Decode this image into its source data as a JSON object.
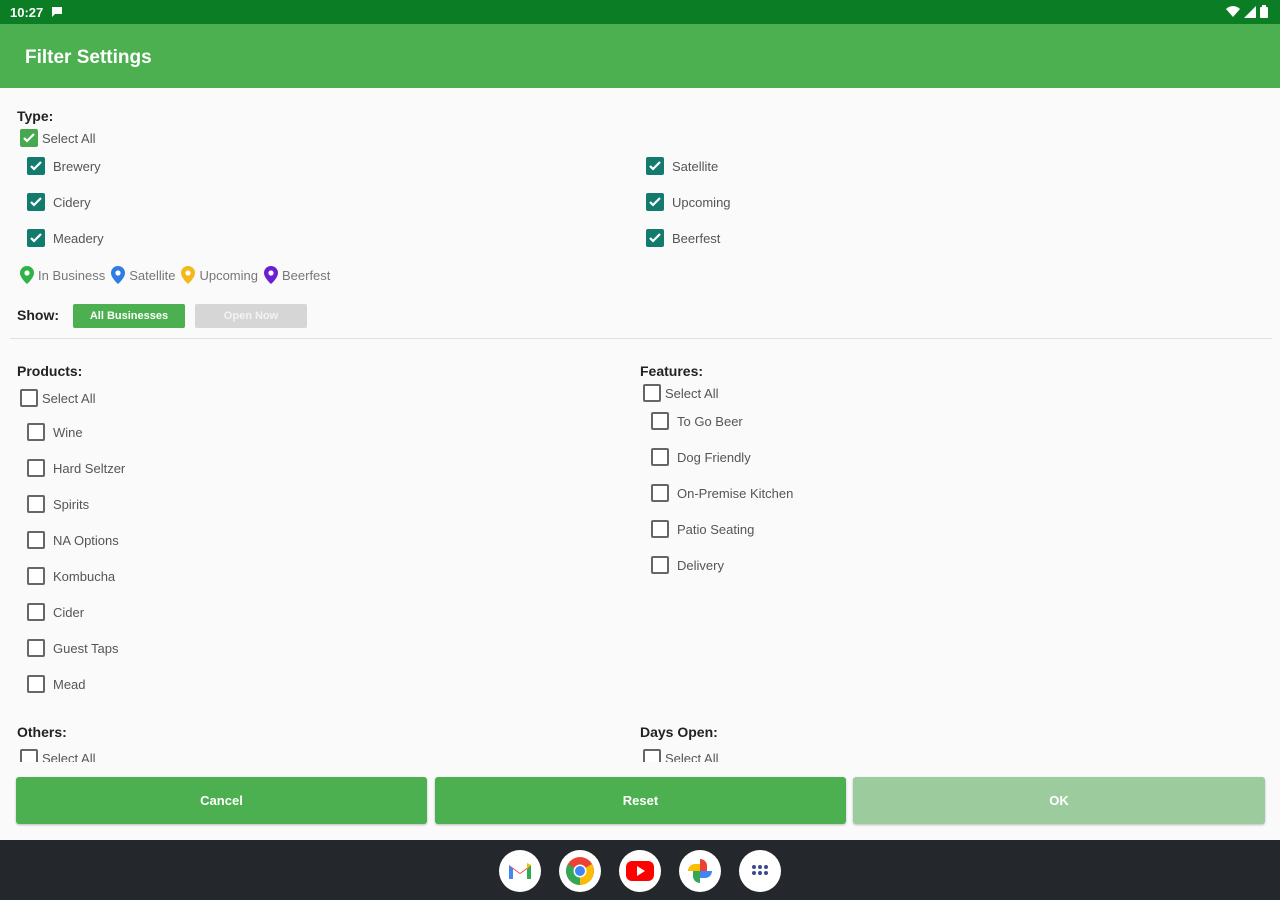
{
  "status_bar": {
    "time": "10:27"
  },
  "app_bar": {
    "title": "Filter Settings"
  },
  "type_section": {
    "label": "Type:",
    "select_all": {
      "label": "Select All",
      "checked": true
    },
    "items_left": [
      {
        "label": "Brewery",
        "checked": true
      },
      {
        "label": "Cidery",
        "checked": true
      },
      {
        "label": "Meadery",
        "checked": true
      }
    ],
    "items_right": [
      {
        "label": "Satellite",
        "checked": true
      },
      {
        "label": "Upcoming",
        "checked": true
      },
      {
        "label": "Beerfest",
        "checked": true
      }
    ]
  },
  "legend": [
    {
      "label": "In Business",
      "color": "#2fb344"
    },
    {
      "label": "Satellite",
      "color": "#2f7de1"
    },
    {
      "label": "Upcoming",
      "color": "#f1b91c"
    },
    {
      "label": "Beerfest",
      "color": "#6a1fd0"
    }
  ],
  "show": {
    "label": "Show:",
    "options": [
      {
        "label": "All Businesses",
        "active": true
      },
      {
        "label": "Open Now",
        "active": false
      }
    ]
  },
  "products": {
    "label": "Products:",
    "select_all": {
      "label": "Select All",
      "checked": false
    },
    "items": [
      {
        "label": "Wine",
        "checked": false
      },
      {
        "label": "Hard Seltzer",
        "checked": false
      },
      {
        "label": "Spirits",
        "checked": false
      },
      {
        "label": "NA Options",
        "checked": false
      },
      {
        "label": "Kombucha",
        "checked": false
      },
      {
        "label": "Cider",
        "checked": false
      },
      {
        "label": "Guest Taps",
        "checked": false
      },
      {
        "label": "Mead",
        "checked": false
      }
    ]
  },
  "features": {
    "label": "Features:",
    "select_all": {
      "label": "Select All",
      "checked": false
    },
    "items": [
      {
        "label": "To Go Beer",
        "checked": false
      },
      {
        "label": "Dog Friendly",
        "checked": false
      },
      {
        "label": "On-Premise Kitchen",
        "checked": false
      },
      {
        "label": "Patio Seating",
        "checked": false
      },
      {
        "label": "Delivery",
        "checked": false
      }
    ]
  },
  "others": {
    "label": "Others:",
    "select_all": {
      "label": "Select All",
      "checked": false
    }
  },
  "days_open": {
    "label": "Days Open:",
    "select_all": {
      "label": "Select All",
      "checked": false
    }
  },
  "footer": {
    "cancel_label": "Cancel",
    "reset_label": "Reset",
    "ok_label": "OK",
    "ok_enabled": false
  },
  "dock_apps": [
    "gmail-icon",
    "chrome-icon",
    "youtube-icon",
    "photos-icon",
    "app-drawer-icon"
  ],
  "colors": {
    "status_bar": "#0b7d24",
    "app_bar": "#4caf50",
    "checkbox_checked": "#137b6e",
    "button": "#4caf50",
    "button_disabled": "#9ccc9e",
    "nav_bar": "#24272b"
  }
}
